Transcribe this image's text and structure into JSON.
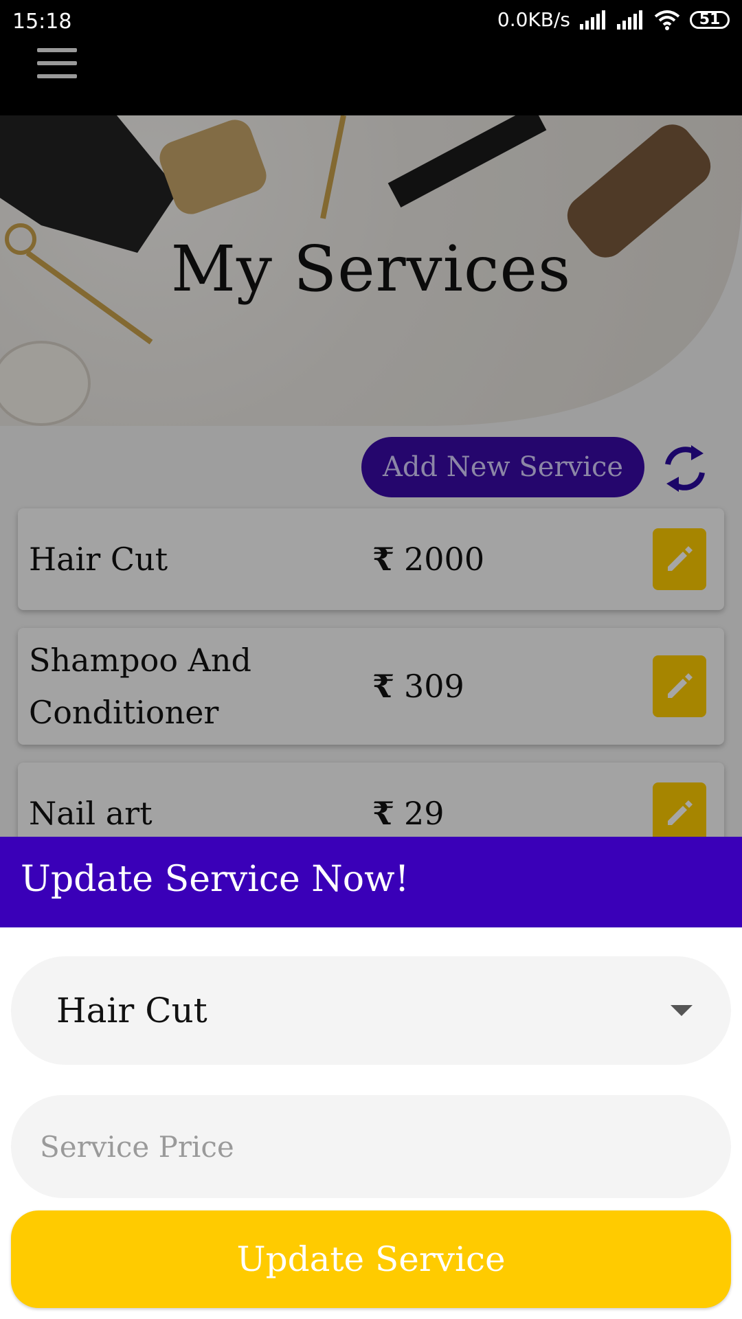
{
  "status_bar": {
    "time": "15:18",
    "network_speed": "0.0KB/s",
    "battery": "51",
    "icons": [
      "signal-icon",
      "signal-icon",
      "wifi-icon",
      "battery-icon"
    ]
  },
  "app_bar": {
    "menu_icon": "menu-icon"
  },
  "hero": {
    "title": "My Services"
  },
  "actions": {
    "add_label": "Add New Service",
    "refresh_icon": "refresh-icon"
  },
  "services": [
    {
      "name": "Hair Cut",
      "currency": "₹",
      "price": "2000"
    },
    {
      "name": "Shampoo And Conditioner",
      "currency": "₹",
      "price": "309"
    },
    {
      "name": "Nail art",
      "currency": "₹",
      "price": "29"
    }
  ],
  "sheet": {
    "title": "Update Service Now!",
    "selected_service": "Hair Cut",
    "price_placeholder": "Service Price",
    "price_value": "",
    "submit_label": "Update Service"
  },
  "colors": {
    "primary": "#3a00b8",
    "accent": "#ffcb00",
    "status_bar": "#000000"
  }
}
